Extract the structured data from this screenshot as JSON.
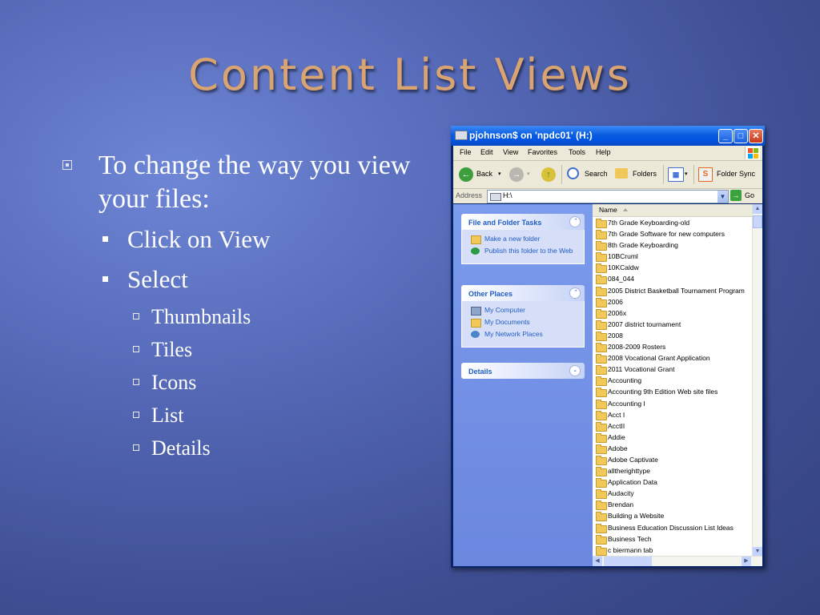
{
  "slide": {
    "title": "Content List Views",
    "bullets": {
      "main": "To change the way you view your files:",
      "sub1": "Click on View",
      "sub2": "Select",
      "views": [
        "Thumbnails",
        "Tiles",
        "Icons",
        "List",
        "Details"
      ]
    }
  },
  "window": {
    "title": "pjohnson$ on 'npdc01' (H:)",
    "menu": [
      "File",
      "Edit",
      "View",
      "Favorites",
      "Tools",
      "Help"
    ],
    "toolbar": {
      "back": "Back",
      "search": "Search",
      "folders": "Folders",
      "folder_sync": "Folder Sync"
    },
    "address": {
      "label": "Address",
      "value": "H:\\",
      "go": "Go"
    },
    "tasks": {
      "file_folder": {
        "title": "File and Folder Tasks",
        "items": [
          "Make a new folder",
          "Publish this folder to the Web"
        ]
      },
      "other_places": {
        "title": "Other Places",
        "items": [
          "My Computer",
          "My Documents",
          "My Network Places"
        ]
      },
      "details": {
        "title": "Details"
      }
    },
    "files": {
      "column": "Name",
      "items": [
        "7th Grade Keyboarding-old",
        "7th Grade Software for new computers",
        "8th Grade Keyboarding",
        "10BCruml",
        "10KCaldw",
        "084_044",
        "2005 District Basketball Tournament Program",
        "2006",
        "2006x",
        "2007 district tournament",
        "2008",
        "2008-2009 Rosters",
        "2008 Vocational Grant Application",
        "2011 Vocational Grant",
        "Accounting",
        "Accounting 9th Edition Web site files",
        "Accounting I",
        "Acct I",
        "AcctII",
        "Addie",
        "Adobe",
        "Adobe Captivate",
        "alltherighttype",
        "Application Data",
        "Audacity",
        "Brendan",
        "Building a Website",
        "Business Education Discussion List Ideas",
        "Business Tech",
        "c biermann tab"
      ]
    },
    "colors": {
      "titlebar": "#0055e5",
      "taskpane": "#7b9bec",
      "link": "#215dc6"
    }
  }
}
